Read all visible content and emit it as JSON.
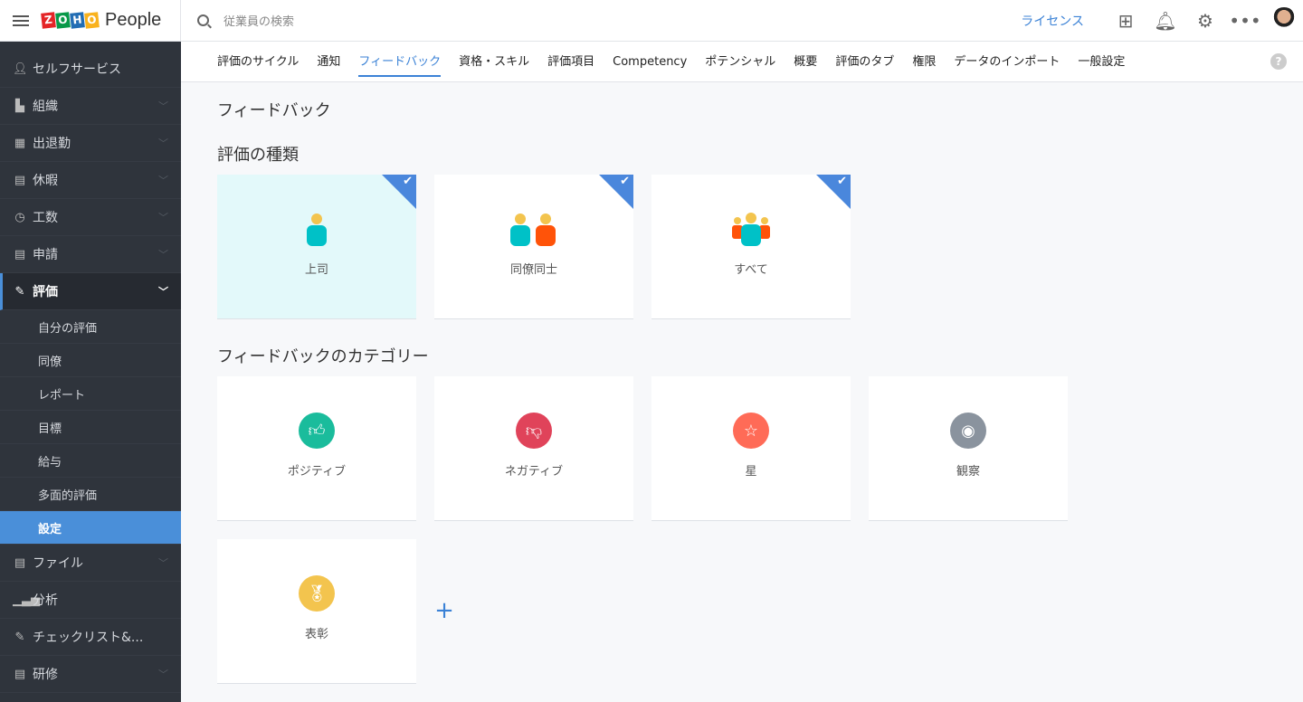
{
  "header": {
    "brand_letters": [
      "Z",
      "O",
      "H",
      "O"
    ],
    "brand": "People",
    "search_placeholder": "従業員の検索",
    "license": "ライセンス"
  },
  "sidebar": {
    "items": [
      {
        "label": "セルフサービス",
        "icon": "person-icon"
      },
      {
        "label": "組織",
        "icon": "building-icon"
      },
      {
        "label": "出退勤",
        "icon": "calendar-icon"
      },
      {
        "label": "休暇",
        "icon": "leave-icon"
      },
      {
        "label": "工数",
        "icon": "clock-icon"
      },
      {
        "label": "申請",
        "icon": "form-icon"
      },
      {
        "label": "評価",
        "icon": "appraisal-icon"
      }
    ],
    "subitems": [
      "自分の評価",
      "同僚",
      "レポート",
      "目標",
      "給与",
      "多面的評価",
      "設定"
    ],
    "bottom": [
      {
        "label": "ファイル"
      },
      {
        "label": "分析"
      },
      {
        "label": "チェックリスト&..."
      },
      {
        "label": "研修"
      }
    ]
  },
  "tabs": [
    "評価のサイクル",
    "通知",
    "フィードバック",
    "資格・スキル",
    "評価項目",
    "Competency",
    "ポテンシャル",
    "概要",
    "評価のタブ",
    "権限",
    "データのインポート",
    "一般設定"
  ],
  "main": {
    "title": "フィードバック",
    "types_heading": "評価の種類",
    "types": [
      {
        "label": "上司",
        "checked": true
      },
      {
        "label": "同僚同士",
        "checked": true
      },
      {
        "label": "すべて",
        "checked": true
      }
    ],
    "categories_heading": "フィードバックのカテゴリー",
    "categories": [
      {
        "label": "ポジティブ",
        "color": "#1abc9c",
        "icon": "thumbs-up-icon"
      },
      {
        "label": "ネガティブ",
        "color": "#e0435a",
        "icon": "thumbs-down-icon"
      },
      {
        "label": "星",
        "color": "#ff6b57",
        "icon": "star-icon"
      },
      {
        "label": "観察",
        "color": "#8a939e",
        "icon": "eye-icon"
      },
      {
        "label": "表彰",
        "color": "#f3c44e",
        "icon": "award-icon"
      }
    ]
  },
  "colors": {
    "accent": "#4a8fd9",
    "sidebar": "#2f343c"
  }
}
